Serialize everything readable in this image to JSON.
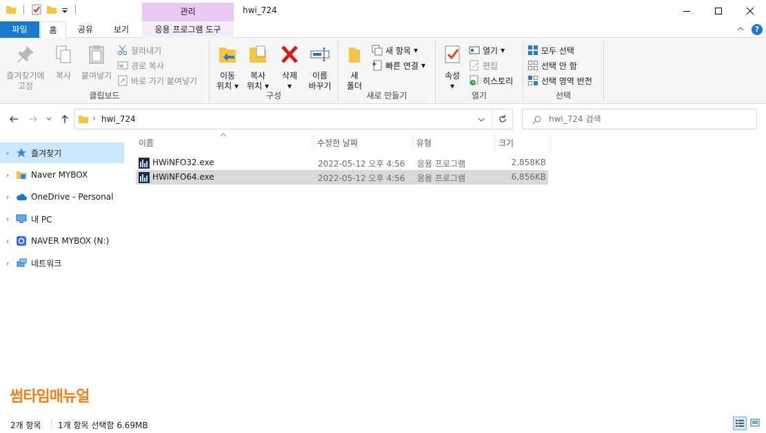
{
  "window": {
    "title": "hwi_724",
    "context_tab_header": "관리"
  },
  "tabs": {
    "file": "파일",
    "home": "홈",
    "share": "공유",
    "view": "보기",
    "context": "응용 프로그램 도구"
  },
  "ribbon": {
    "clipboard": {
      "pin_line1": "즐겨찾기에",
      "pin_line2": "고정",
      "copy": "복사",
      "paste": "붙여넣기",
      "cut": "잘라내기",
      "copy_path": "경로 복사",
      "paste_shortcut": "바로 가기 붙여넣기",
      "label": "클립보드"
    },
    "organize": {
      "move_line1": "이동",
      "move_line2": "위치",
      "copy_line1": "복사",
      "copy_line2": "위치",
      "delete": "삭제",
      "rename_line1": "이름",
      "rename_line2": "바꾸기",
      "label": "구성"
    },
    "new": {
      "new_folder_line1": "새",
      "new_folder_line2": "폴더",
      "new_item": "새 항목",
      "easy_access": "빠른 연결",
      "label": "새로 만들기"
    },
    "open": {
      "properties": "속성",
      "open": "열기",
      "edit": "편집",
      "history": "히스토리",
      "label": "열기"
    },
    "select": {
      "select_all": "모두 선택",
      "select_none": "선택 안 함",
      "invert": "선택 영역 반전",
      "label": "선택"
    }
  },
  "address": {
    "path": "hwi_724",
    "search_placeholder": "hwi_724 검색"
  },
  "nav": [
    {
      "label": "즐겨찾기"
    },
    {
      "label": "Naver MYBOX"
    },
    {
      "label": "OneDrive - Personal"
    },
    {
      "label": "내 PC"
    },
    {
      "label": "NAVER MYBOX (N:)"
    },
    {
      "label": "네트워크"
    }
  ],
  "columns": {
    "name": "이름",
    "date": "수정한 날짜",
    "type": "유형",
    "size": "크기"
  },
  "files": [
    {
      "name": "HWiNFO32.exe",
      "date": "2022-05-12 오후 4:56",
      "type": "응용 프로그램",
      "size": "2,858KB"
    },
    {
      "name": "HWiNFO64.exe",
      "date": "2022-05-12 오후 4:56",
      "type": "응용 프로그램",
      "size": "6,856KB"
    }
  ],
  "status": {
    "count": "2개 항목",
    "selection": "1개 항목 선택함 6.69MB"
  },
  "watermark": "썸타임매뉴얼",
  "colors": {
    "accent": "#1979ca",
    "context_tab": "#e8c9f2",
    "selection": "#cce8ff",
    "watermark": "#f57e12"
  }
}
